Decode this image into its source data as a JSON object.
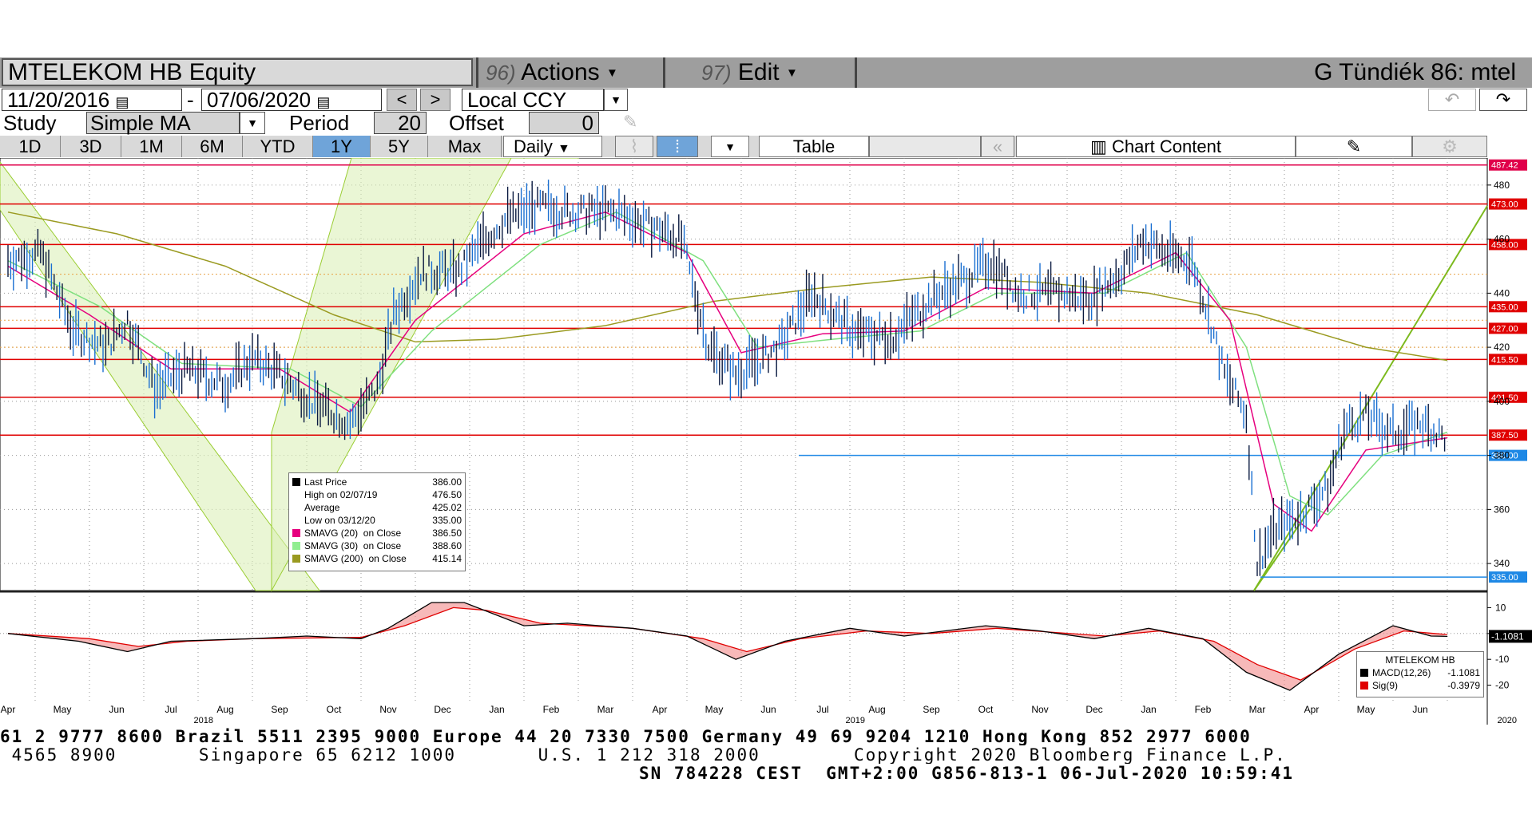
{
  "header": {
    "ticker": "MTELEKOM HB Equity",
    "actions_num": "96)",
    "actions_label": "Actions",
    "edit_num": "97)",
    "edit_label": "Edit",
    "user": "G Tündiék 86: mtel"
  },
  "controls": {
    "start_date": "11/20/2016",
    "date_sep": "-",
    "end_date": "07/06/2020",
    "prev": "<",
    "next": ">",
    "currency": "Local CCY",
    "study_label": "Study",
    "study_value": "Simple MA",
    "period_label": "Period",
    "period_value": "20",
    "offset_label": "Offset",
    "offset_value": "0"
  },
  "tabs": {
    "ranges": [
      "1D",
      "3D",
      "1M",
      "6M",
      "YTD",
      "1Y",
      "5Y",
      "Max"
    ],
    "selected": "1Y",
    "frequency": "Daily",
    "table": "Table",
    "chart_content": "Chart Content"
  },
  "legend": {
    "rows": [
      {
        "label": "Last Price",
        "value": "386.00",
        "color": "#000000"
      },
      {
        "label": "High on 02/07/19",
        "value": "476.50",
        "color": ""
      },
      {
        "label": "Average",
        "value": "425.02",
        "color": ""
      },
      {
        "label": "Low on 03/12/20",
        "value": "335.00",
        "color": ""
      },
      {
        "label": "SMAVG (20)  on Close",
        "value": "386.50",
        "color": "#e6007e"
      },
      {
        "label": "SMAVG (30)  on Close",
        "value": "388.60",
        "color": "#90ee90"
      },
      {
        "label": "SMAVG (200)  on Close",
        "value": "415.14",
        "color": "#9a9a20"
      }
    ]
  },
  "macd_legend": {
    "title": "MTELEKOM HB",
    "rows": [
      {
        "label": "MACD(12,26)",
        "value": "-1.1081",
        "color": "#000000"
      },
      {
        "label": "Sig(9)",
        "value": "-0.3979",
        "color": "#e00000"
      }
    ]
  },
  "chart_data": {
    "type": "line",
    "title": "MTELEKOM HB Equity",
    "x_months": [
      "Apr",
      "May",
      "Jun",
      "Jul",
      "Aug",
      "Sep",
      "Oct",
      "Nov",
      "Dec",
      "Jan",
      "Feb",
      "Mar",
      "Apr",
      "May",
      "Jun",
      "Jul",
      "Aug",
      "Sep",
      "Oct",
      "Nov",
      "Dec",
      "Jan",
      "Feb",
      "Mar",
      "Apr",
      "May",
      "Jun"
    ],
    "x_years": [
      "2018",
      "2019",
      "2020"
    ],
    "y_ticks": [
      340,
      360,
      380,
      400,
      420,
      440,
      460,
      480
    ],
    "ylim": [
      330,
      490
    ],
    "price_levels": [
      {
        "value": 487.42,
        "label": "487.42",
        "color": "#e0004a"
      },
      {
        "value": 473.0,
        "label": "473.00",
        "color": "#e00000"
      },
      {
        "value": 458.0,
        "label": "458.00",
        "color": "#e00000"
      },
      {
        "value": 435.0,
        "label": "435.00",
        "color": "#e00000"
      },
      {
        "value": 427.0,
        "label": "427.00",
        "color": "#e00000"
      },
      {
        "value": 415.5,
        "label": "415.50",
        "color": "#e00000"
      },
      {
        "value": 401.5,
        "label": "401.50",
        "color": "#e00000"
      },
      {
        "value": 387.5,
        "label": "387.50",
        "color": "#e00000"
      },
      {
        "value": 380.0,
        "label": "380.00",
        "color": "#1e88e5"
      },
      {
        "value": 335.0,
        "label": "335.00",
        "color": "#1e88e5"
      }
    ],
    "price_series": [
      {
        "month": 0.0,
        "value": 452
      },
      {
        "month": 0.6,
        "value": 455
      },
      {
        "month": 1.2,
        "value": 426
      },
      {
        "month": 1.8,
        "value": 420
      },
      {
        "month": 2.2,
        "value": 430
      },
      {
        "month": 2.7,
        "value": 405
      },
      {
        "month": 3.3,
        "value": 412
      },
      {
        "month": 4.0,
        "value": 406
      },
      {
        "month": 4.5,
        "value": 416
      },
      {
        "month": 5.0,
        "value": 410
      },
      {
        "month": 5.6,
        "value": 400
      },
      {
        "month": 6.3,
        "value": 392
      },
      {
        "month": 6.8,
        "value": 405
      },
      {
        "month": 7.1,
        "value": 432
      },
      {
        "month": 7.6,
        "value": 448
      },
      {
        "month": 8.3,
        "value": 448
      },
      {
        "month": 8.7,
        "value": 458
      },
      {
        "month": 9.2,
        "value": 468
      },
      {
        "month": 9.8,
        "value": 472
      },
      {
        "month": 10.5,
        "value": 470
      },
      {
        "month": 11.2,
        "value": 470
      },
      {
        "month": 11.8,
        "value": 465
      },
      {
        "month": 12.4,
        "value": 460
      },
      {
        "month": 12.9,
        "value": 420
      },
      {
        "month": 13.4,
        "value": 410
      },
      {
        "month": 14.2,
        "value": 420
      },
      {
        "month": 14.8,
        "value": 440
      },
      {
        "month": 15.6,
        "value": 425
      },
      {
        "month": 16.3,
        "value": 424
      },
      {
        "month": 17.0,
        "value": 438
      },
      {
        "month": 17.6,
        "value": 445
      },
      {
        "month": 18.1,
        "value": 452
      },
      {
        "month": 18.6,
        "value": 440
      },
      {
        "month": 19.3,
        "value": 440
      },
      {
        "month": 19.9,
        "value": 438
      },
      {
        "month": 20.5,
        "value": 448
      },
      {
        "month": 20.9,
        "value": 460
      },
      {
        "month": 21.3,
        "value": 455
      },
      {
        "month": 21.8,
        "value": 452
      },
      {
        "month": 22.1,
        "value": 432
      },
      {
        "month": 22.4,
        "value": 410
      },
      {
        "month": 22.8,
        "value": 395
      },
      {
        "month": 23.0,
        "value": 340
      },
      {
        "month": 23.3,
        "value": 352
      },
      {
        "month": 23.8,
        "value": 358
      },
      {
        "month": 24.3,
        "value": 368
      },
      {
        "month": 24.6,
        "value": 390
      },
      {
        "month": 25.0,
        "value": 395
      },
      {
        "month": 25.5,
        "value": 388
      },
      {
        "month": 26.0,
        "value": 392
      },
      {
        "month": 26.5,
        "value": 386
      }
    ],
    "sma20": [
      {
        "month": 0.0,
        "value": 450
      },
      {
        "month": 1.5,
        "value": 432
      },
      {
        "month": 3.0,
        "value": 412
      },
      {
        "month": 5.0,
        "value": 412
      },
      {
        "month": 6.3,
        "value": 396
      },
      {
        "month": 7.5,
        "value": 430
      },
      {
        "month": 9.5,
        "value": 462
      },
      {
        "month": 11.0,
        "value": 470
      },
      {
        "month": 12.5,
        "value": 455
      },
      {
        "month": 13.5,
        "value": 418
      },
      {
        "month": 15.0,
        "value": 425
      },
      {
        "month": 16.5,
        "value": 426
      },
      {
        "month": 18.0,
        "value": 442
      },
      {
        "month": 20.0,
        "value": 440
      },
      {
        "month": 21.5,
        "value": 455
      },
      {
        "month": 22.5,
        "value": 430
      },
      {
        "month": 23.3,
        "value": 362
      },
      {
        "month": 24.0,
        "value": 352
      },
      {
        "month": 25.0,
        "value": 382
      },
      {
        "month": 26.5,
        "value": 386.5
      }
    ],
    "sma30": [
      {
        "month": 0.0,
        "value": 452
      },
      {
        "month": 1.7,
        "value": 435
      },
      {
        "month": 3.2,
        "value": 414
      },
      {
        "month": 5.2,
        "value": 412
      },
      {
        "month": 6.5,
        "value": 398
      },
      {
        "month": 7.8,
        "value": 426
      },
      {
        "month": 9.8,
        "value": 458
      },
      {
        "month": 11.2,
        "value": 470
      },
      {
        "month": 12.8,
        "value": 452
      },
      {
        "month": 13.8,
        "value": 420
      },
      {
        "month": 15.2,
        "value": 423
      },
      {
        "month": 16.8,
        "value": 426
      },
      {
        "month": 18.2,
        "value": 440
      },
      {
        "month": 20.2,
        "value": 440
      },
      {
        "month": 21.7,
        "value": 455
      },
      {
        "month": 22.8,
        "value": 420
      },
      {
        "month": 23.6,
        "value": 365
      },
      {
        "month": 24.3,
        "value": 358
      },
      {
        "month": 25.3,
        "value": 380
      },
      {
        "month": 26.5,
        "value": 388.6
      }
    ],
    "sma200": [
      {
        "month": 0.0,
        "value": 470
      },
      {
        "month": 2.0,
        "value": 462
      },
      {
        "month": 4.0,
        "value": 450
      },
      {
        "month": 6.0,
        "value": 432
      },
      {
        "month": 7.5,
        "value": 422
      },
      {
        "month": 9.0,
        "value": 423
      },
      {
        "month": 11.0,
        "value": 428
      },
      {
        "month": 13.0,
        "value": 437
      },
      {
        "month": 15.0,
        "value": 442
      },
      {
        "month": 17.0,
        "value": 446
      },
      {
        "month": 19.0,
        "value": 444
      },
      {
        "month": 21.0,
        "value": 440
      },
      {
        "month": 23.0,
        "value": 432
      },
      {
        "month": 25.0,
        "value": 420
      },
      {
        "month": 26.5,
        "value": 415.14
      }
    ],
    "macd": {
      "y_ticks": [
        10,
        0,
        -10,
        -20
      ],
      "ylim": [
        -26,
        16
      ],
      "macd_series": [
        {
          "month": 0.0,
          "value": 0
        },
        {
          "month": 1.3,
          "value": -3
        },
        {
          "month": 2.2,
          "value": -7
        },
        {
          "month": 3.0,
          "value": -3
        },
        {
          "month": 4.5,
          "value": -2
        },
        {
          "month": 5.5,
          "value": -1
        },
        {
          "month": 6.5,
          "value": -2
        },
        {
          "month": 7.0,
          "value": 2
        },
        {
          "month": 7.8,
          "value": 12
        },
        {
          "month": 8.4,
          "value": 12
        },
        {
          "month": 9.5,
          "value": 3
        },
        {
          "month": 10.3,
          "value": 4
        },
        {
          "month": 11.5,
          "value": 2
        },
        {
          "month": 12.5,
          "value": -1
        },
        {
          "month": 13.4,
          "value": -10
        },
        {
          "month": 14.3,
          "value": -3
        },
        {
          "month": 15.5,
          "value": 2
        },
        {
          "month": 16.5,
          "value": -1
        },
        {
          "month": 18.0,
          "value": 3
        },
        {
          "month": 19.0,
          "value": 1
        },
        {
          "month": 20.0,
          "value": -2
        },
        {
          "month": 21.0,
          "value": 2
        },
        {
          "month": 22.0,
          "value": -2
        },
        {
          "month": 22.8,
          "value": -15
        },
        {
          "month": 23.6,
          "value": -22
        },
        {
          "month": 24.5,
          "value": -8
        },
        {
          "month": 25.5,
          "value": 3
        },
        {
          "month": 26.2,
          "value": -1
        },
        {
          "month": 26.5,
          "value": -1.1081
        }
      ],
      "signal_series": [
        {
          "month": 0.0,
          "value": 0
        },
        {
          "month": 1.5,
          "value": -2
        },
        {
          "month": 2.4,
          "value": -5
        },
        {
          "month": 3.3,
          "value": -3
        },
        {
          "month": 4.5,
          "value": -2
        },
        {
          "month": 6.5,
          "value": -1.5
        },
        {
          "month": 7.3,
          "value": 3
        },
        {
          "month": 8.2,
          "value": 10
        },
        {
          "month": 8.8,
          "value": 9
        },
        {
          "month": 9.8,
          "value": 4
        },
        {
          "month": 11.5,
          "value": 2
        },
        {
          "month": 12.8,
          "value": -2
        },
        {
          "month": 13.6,
          "value": -7
        },
        {
          "month": 14.6,
          "value": -2
        },
        {
          "month": 15.8,
          "value": 1
        },
        {
          "month": 17.0,
          "value": 0
        },
        {
          "month": 18.2,
          "value": 2
        },
        {
          "month": 20.2,
          "value": -1
        },
        {
          "month": 21.2,
          "value": 1
        },
        {
          "month": 22.2,
          "value": -3
        },
        {
          "month": 23.0,
          "value": -12
        },
        {
          "month": 23.8,
          "value": -18
        },
        {
          "month": 24.8,
          "value": -6
        },
        {
          "month": 25.7,
          "value": 1
        },
        {
          "month": 26.5,
          "value": -0.3979
        }
      ],
      "last_label": "-1.1081"
    }
  },
  "footer": {
    "line1": "61 2 9777 8600 Brazil 5511 2395 9000 Europe 44 20 7330 7500 Germany 49 69 9204 1210 Hong Kong 852 2977 6000",
    "line2": " 4565 8900       Singapore 65 6212 1000       U.S. 1 212 318 2000        Copyright 2020 Bloomberg Finance L.P.",
    "line3": "SN 784228 CEST  GMT+2:00 G856-813-1 06-Jul-2020 10:59:41"
  }
}
